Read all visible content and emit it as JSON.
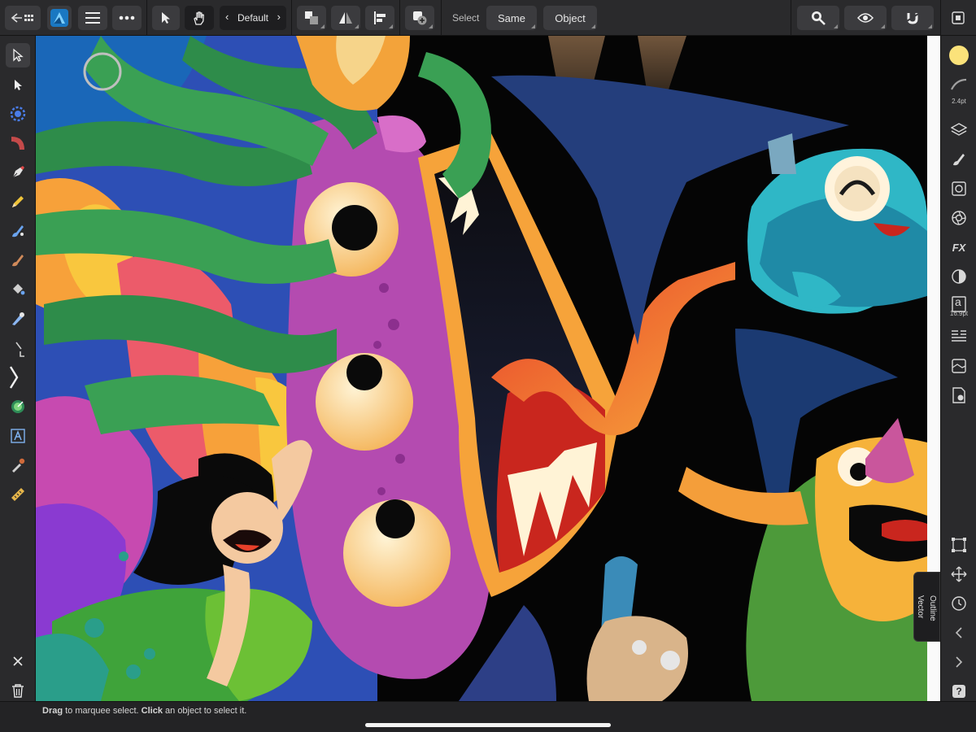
{
  "toolbar": {
    "style_preset": "Default",
    "select_label": "Select",
    "same_button": "Same",
    "object_button": "Object"
  },
  "left_tools": [
    "move-tool",
    "node-tool",
    "corner-tool",
    "pencil-tool",
    "pen-tool",
    "vector-brush-tool",
    "fill-tool",
    "brush-tool",
    "pixel-brush-tool",
    "erase-tool",
    "crop-tool",
    "transparency-tool",
    "artistic-text-tool",
    "color-picker-tool",
    "measure-tool"
  ],
  "right_panel": {
    "stroke_width": "2.4pt",
    "text_size": "16.9pt",
    "fx_label": "FX",
    "text_icon_glyph": "a",
    "help_glyph": "?"
  },
  "canvas_tabs": {
    "vector": "Vector",
    "outline": "Outline"
  },
  "status": {
    "drag": "Drag",
    "drag_text": " to marquee select. ",
    "click": "Click",
    "click_text": " an object to select it."
  },
  "colors": {
    "accent_primary": "#fbe27a",
    "canvas_bg": "#050505",
    "ui_bg": "#2a2a2c"
  }
}
